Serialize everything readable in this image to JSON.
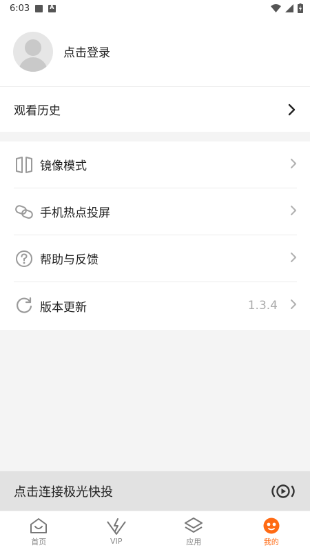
{
  "status_bar": {
    "time": "6:03"
  },
  "profile": {
    "login_label": "点击登录"
  },
  "history": {
    "label": "观看历史"
  },
  "menu": {
    "items": [
      {
        "label": "镜像模式",
        "icon": "mirror-icon"
      },
      {
        "label": "手机热点投屏",
        "icon": "link-icon"
      },
      {
        "label": "帮助与反馈",
        "icon": "help-icon"
      },
      {
        "label": "版本更新",
        "icon": "refresh-icon",
        "value": "1.3.4"
      }
    ]
  },
  "connect_bar": {
    "label": "点击连接极光快投"
  },
  "tabbar": {
    "tabs": [
      {
        "label": "首页",
        "icon": "home-icon"
      },
      {
        "label": "VIP",
        "icon": "vip-icon"
      },
      {
        "label": "应用",
        "icon": "layers-icon"
      },
      {
        "label": "我的",
        "icon": "face-icon",
        "active": true
      }
    ]
  },
  "colors": {
    "accent": "#ff6a13",
    "icon_gray": "#9a9a9a",
    "text": "#222222"
  }
}
